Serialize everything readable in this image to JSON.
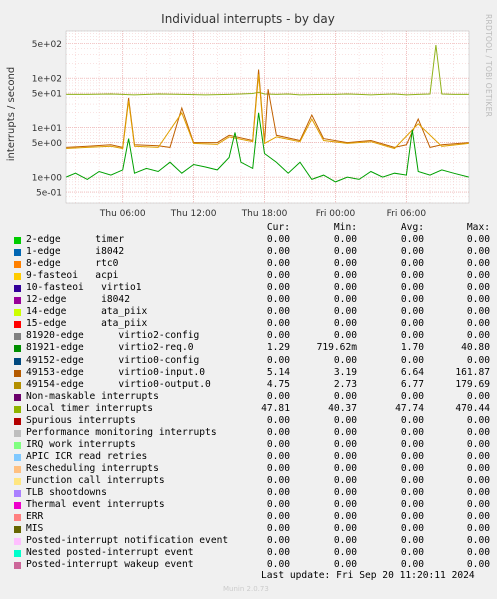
{
  "chart_data": {
    "type": "line",
    "title": "Individual interrupts - by day",
    "ylabel": "interrupts / second",
    "yscale": "log",
    "ylim": [
      0.3,
      900
    ],
    "yticks": [
      {
        "value": 500,
        "label": "5e+02"
      },
      {
        "value": 100,
        "label": "1e+02"
      },
      {
        "value": 50,
        "label": "5e+01"
      },
      {
        "value": 10,
        "label": "1e+01"
      },
      {
        "value": 5,
        "label": "5e+00"
      },
      {
        "value": 1,
        "label": "1e+00"
      },
      {
        "value": 0.5,
        "label": "5e-01"
      }
    ],
    "xticks": [
      {
        "hour": 6,
        "label": "Thu 06:00"
      },
      {
        "hour": 12,
        "label": "Thu 12:00"
      },
      {
        "hour": 18,
        "label": "Thu 18:00"
      },
      {
        "hour": 24,
        "label": "Fri 00:00"
      },
      {
        "hour": 30,
        "label": "Fri 06:00"
      }
    ],
    "xlim_hours": [
      1.2,
      35.3
    ],
    "grid": true,
    "series": [
      {
        "name": "Local timer interrupts",
        "color": "#8FB21A",
        "x": [
          1.2,
          3,
          5,
          6,
          7,
          9,
          11,
          13,
          15,
          16,
          17,
          17.5,
          18,
          19,
          20,
          21,
          23,
          24,
          25,
          26,
          27,
          28,
          29,
          30,
          31,
          32,
          32.5,
          33,
          34,
          35.3
        ],
        "y": [
          47,
          47,
          48,
          47,
          46,
          48,
          47,
          46,
          47,
          48,
          49,
          52,
          48,
          47,
          48,
          46,
          47,
          47,
          48,
          47,
          46,
          47,
          48,
          46,
          47,
          48,
          470,
          48,
          47,
          47
        ]
      },
      {
        "name": "49153-edge virtio0-input.0",
        "color": "#C06000",
        "x": [
          1.2,
          3,
          5,
          6,
          6.5,
          7,
          9,
          10,
          11,
          12,
          14,
          15,
          17,
          17.5,
          18,
          18.3,
          19,
          21,
          22,
          23,
          25,
          27,
          29,
          30,
          31,
          32,
          33,
          35.3
        ],
        "y": [
          4,
          4.2,
          4.5,
          4,
          40,
          4.5,
          4.3,
          4,
          25,
          5,
          5,
          7,
          5.5,
          150,
          5,
          60,
          7,
          5.5,
          18,
          6,
          5,
          5.5,
          4,
          4.5,
          15,
          4,
          4.5,
          5
        ]
      },
      {
        "name": "49154-edge virtio0-output.0",
        "color": "#E0A000",
        "x": [
          1.2,
          3,
          5,
          6,
          6.5,
          7,
          9,
          11,
          12,
          14,
          15,
          17,
          17.5,
          18,
          19,
          21,
          22,
          23,
          25,
          27,
          29,
          31,
          33,
          35.3
        ],
        "y": [
          3.8,
          4,
          4.2,
          3.8,
          35,
          4.2,
          4,
          20,
          4.8,
          4.6,
          6.5,
          5.2,
          120,
          4.8,
          6.5,
          5.2,
          15,
          5.5,
          4.8,
          5.2,
          3.8,
          12,
          4.2,
          4.8
        ]
      },
      {
        "name": "81921-edge virtio2-req.0",
        "color": "#00A000",
        "x": [
          1.2,
          2,
          3,
          4,
          5,
          6,
          6.5,
          7,
          8,
          9,
          10,
          11,
          12,
          13,
          14,
          15,
          15.5,
          16,
          17,
          17.5,
          18,
          19,
          20,
          21,
          22,
          23,
          24,
          25,
          26,
          27,
          28,
          29,
          30,
          30.5,
          31,
          32,
          33,
          34,
          35.3
        ],
        "y": [
          1.0,
          1.2,
          0.9,
          1.3,
          1.1,
          1.4,
          6,
          1.2,
          1.5,
          1.3,
          2,
          1.2,
          1.8,
          1.6,
          1.4,
          2.5,
          8,
          2,
          1.5,
          20,
          3,
          2,
          1.2,
          2,
          0.9,
          1.1,
          0.8,
          1,
          0.9,
          1.3,
          1,
          1.2,
          1.1,
          9,
          1.3,
          1.1,
          1.4,
          1.2,
          1.0
        ]
      }
    ]
  },
  "legend": {
    "headers": {
      "cur": "Cur:",
      "min": "Min:",
      "avg": "Avg:",
      "max": "Max:"
    },
    "rows": [
      {
        "color": "#00CC00",
        "label": "2-edge      timer",
        "cur": "0.00",
        "min": "0.00",
        "avg": "0.00",
        "max": "0.00"
      },
      {
        "color": "#0066B3",
        "label": "1-edge      i8042",
        "cur": "0.00",
        "min": "0.00",
        "avg": "0.00",
        "max": "0.00"
      },
      {
        "color": "#FF8000",
        "label": "8-edge      rtc0",
        "cur": "0.00",
        "min": "0.00",
        "avg": "0.00",
        "max": "0.00"
      },
      {
        "color": "#FFCC00",
        "label": "9-fasteoi   acpi",
        "cur": "0.00",
        "min": "0.00",
        "avg": "0.00",
        "max": "0.00"
      },
      {
        "color": "#330099",
        "label": "10-fasteoi   virtio1",
        "cur": "0.00",
        "min": "0.00",
        "avg": "0.00",
        "max": "0.00"
      },
      {
        "color": "#990099",
        "label": "12-edge      i8042",
        "cur": "0.00",
        "min": "0.00",
        "avg": "0.00",
        "max": "0.00"
      },
      {
        "color": "#CCFF00",
        "label": "14-edge      ata_piix",
        "cur": "0.00",
        "min": "0.00",
        "avg": "0.00",
        "max": "0.00"
      },
      {
        "color": "#FF0000",
        "label": "15-edge      ata_piix",
        "cur": "0.00",
        "min": "0.00",
        "avg": "0.00",
        "max": "0.00"
      },
      {
        "color": "#808080",
        "label": "81920-edge      virtio2-config",
        "cur": "0.00",
        "min": "0.00",
        "avg": "0.00",
        "max": "0.00"
      },
      {
        "color": "#008F00",
        "label": "81921-edge      virtio2-req.0",
        "cur": "1.29",
        "min": "719.62m",
        "avg": "1.70",
        "max": "40.80"
      },
      {
        "color": "#00487D",
        "label": "49152-edge      virtio0-config",
        "cur": "0.00",
        "min": "0.00",
        "avg": "0.00",
        "max": "0.00"
      },
      {
        "color": "#B35A00",
        "label": "49153-edge      virtio0-input.0",
        "cur": "5.14",
        "min": "3.19",
        "avg": "6.64",
        "max": "161.87"
      },
      {
        "color": "#B38F00",
        "label": "49154-edge      virtio0-output.0",
        "cur": "4.75",
        "min": "2.73",
        "avg": "6.77",
        "max": "179.69"
      },
      {
        "color": "#6B006B",
        "label": "Non-maskable interrupts",
        "cur": "0.00",
        "min": "0.00",
        "avg": "0.00",
        "max": "0.00"
      },
      {
        "color": "#8FB300",
        "label": "Local timer interrupts",
        "cur": "47.81",
        "min": "40.37",
        "avg": "47.74",
        "max": "470.44"
      },
      {
        "color": "#B30000",
        "label": "Spurious interrupts",
        "cur": "0.00",
        "min": "0.00",
        "avg": "0.00",
        "max": "0.00"
      },
      {
        "color": "#BEBEBE",
        "label": "Performance monitoring interrupts",
        "cur": "0.00",
        "min": "0.00",
        "avg": "0.00",
        "max": "0.00"
      },
      {
        "color": "#80FF80",
        "label": "IRQ work interrupts",
        "cur": "0.00",
        "min": "0.00",
        "avg": "0.00",
        "max": "0.00"
      },
      {
        "color": "#80C9FF",
        "label": "APIC ICR read retries",
        "cur": "0.00",
        "min": "0.00",
        "avg": "0.00",
        "max": "0.00"
      },
      {
        "color": "#FFC080",
        "label": "Rescheduling interrupts",
        "cur": "0.00",
        "min": "0.00",
        "avg": "0.00",
        "max": "0.00"
      },
      {
        "color": "#FFE680",
        "label": "Function call interrupts",
        "cur": "0.00",
        "min": "0.00",
        "avg": "0.00",
        "max": "0.00"
      },
      {
        "color": "#AA80FF",
        "label": "TLB shootdowns",
        "cur": "0.00",
        "min": "0.00",
        "avg": "0.00",
        "max": "0.00"
      },
      {
        "color": "#EE00CC",
        "label": "Thermal event interrupts",
        "cur": "0.00",
        "min": "0.00",
        "avg": "0.00",
        "max": "0.00"
      },
      {
        "color": "#FF8080",
        "label": "ERR",
        "cur": "0.00",
        "min": "0.00",
        "avg": "0.00",
        "max": "0.00"
      },
      {
        "color": "#666600",
        "label": "MIS",
        "cur": "0.00",
        "min": "0.00",
        "avg": "0.00",
        "max": "0.00"
      },
      {
        "color": "#FFBFFF",
        "label": "Posted-interrupt notification event",
        "cur": "0.00",
        "min": "0.00",
        "avg": "0.00",
        "max": "0.00"
      },
      {
        "color": "#00FFCC",
        "label": "Nested posted-interrupt event",
        "cur": "0.00",
        "min": "0.00",
        "avg": "0.00",
        "max": "0.00"
      },
      {
        "color": "#CC6699",
        "label": "Posted-interrupt wakeup event",
        "cur": "0.00",
        "min": "0.00",
        "avg": "0.00",
        "max": "0.00"
      }
    ]
  },
  "footer": {
    "last_update": "Last update: Fri Sep 20 11:20:11 2024",
    "generator": "Munin 2.0.73",
    "side_label": "RRDTOOL / TOBI OETIKER"
  }
}
